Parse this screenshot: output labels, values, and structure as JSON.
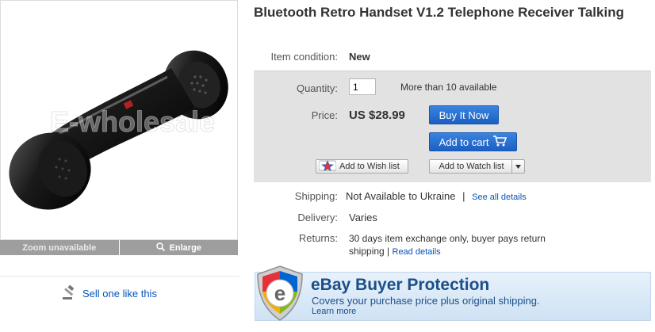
{
  "product": {
    "title": "Bluetooth Retro Handset V1.2 Telephone Receiver Talking",
    "watermark": "E-wholesale"
  },
  "gallery": {
    "zoom_label": "Zoom unavailable",
    "enlarge_label": "Enlarge",
    "sell_label": "Sell one like this"
  },
  "details": {
    "condition_label": "Item condition:",
    "condition_value": "New",
    "quantity_label": "Quantity:",
    "quantity_value": "1",
    "availability": "More than 10 available",
    "price_label": "Price:",
    "price_value": "US $28.99",
    "buy_now_label": "Buy It Now",
    "add_cart_label": "Add to cart",
    "wish_label": "Add to Wish list",
    "watch_label": "Add to Watch list"
  },
  "shipping": {
    "shipping_label": "Shipping:",
    "shipping_value": "Not Available to Ukraine",
    "separator": "|",
    "see_details": "See all details",
    "delivery_label": "Delivery:",
    "delivery_value": "Varies",
    "returns_label": "Returns:",
    "returns_line1": "30 days item exchange only, buyer pays return",
    "returns_line2": "shipping |",
    "read_details": "Read details"
  },
  "protection": {
    "title": "eBay Buyer Protection",
    "subtitle": "Covers your purchase price plus original shipping.",
    "learn_more": "Learn more",
    "shield_letter": "e"
  },
  "colors": {
    "link": "#0654ba",
    "button_blue": "#1b5fc2",
    "box_gray": "#e2e2e2"
  }
}
